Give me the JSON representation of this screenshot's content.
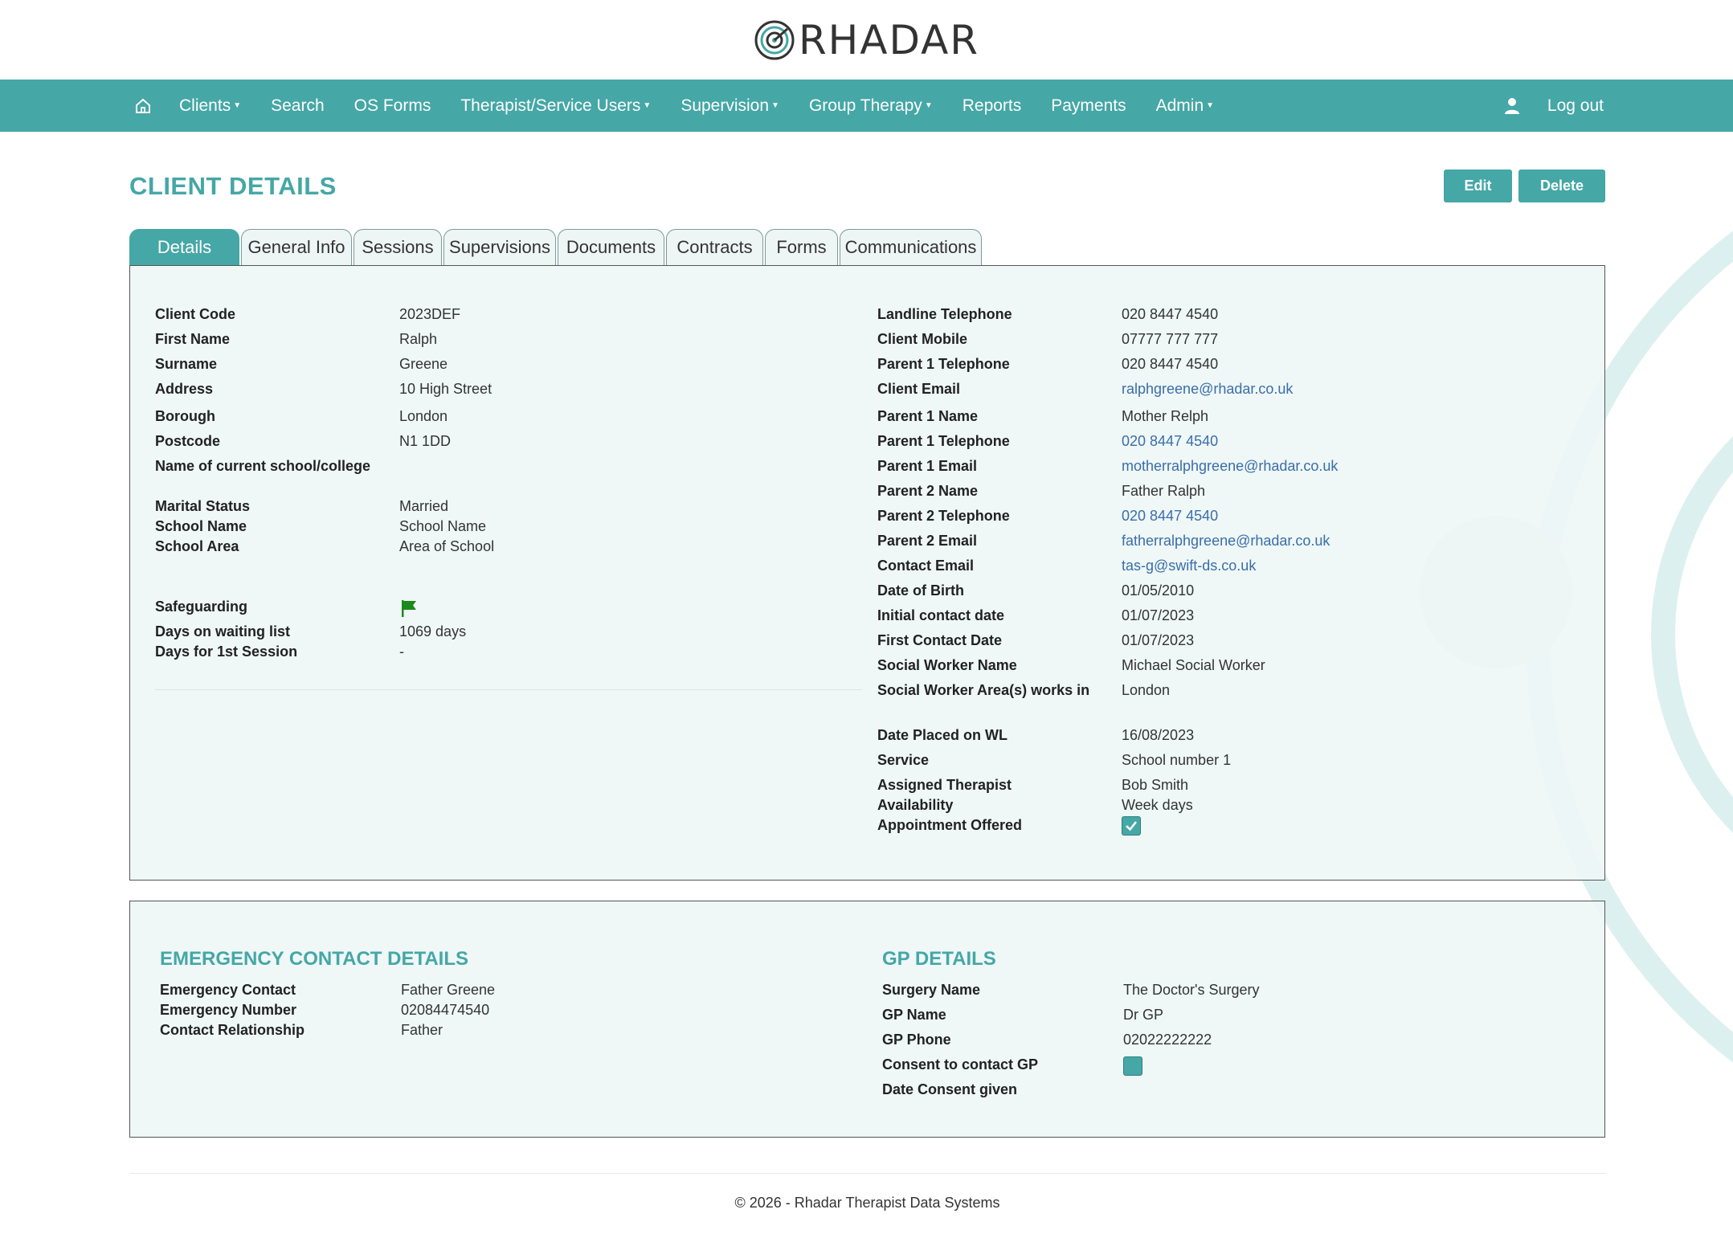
{
  "brand": {
    "name": "RHADAR"
  },
  "nav": {
    "home_icon": "home-icon",
    "items": [
      {
        "label": "Clients",
        "caret": true
      },
      {
        "label": "Search",
        "caret": false
      },
      {
        "label": "OS Forms",
        "caret": false
      },
      {
        "label": "Therapist/Service Users",
        "caret": true
      },
      {
        "label": "Supervision",
        "caret": true
      },
      {
        "label": "Group Therapy",
        "caret": true
      },
      {
        "label": "Reports",
        "caret": false
      },
      {
        "label": "Payments",
        "caret": false
      },
      {
        "label": "Admin",
        "caret": true
      }
    ],
    "user_icon": "user-icon",
    "logout": "Log out"
  },
  "page": {
    "title": "CLIENT DETAILS",
    "edit": "Edit",
    "delete": "Delete"
  },
  "tabs": [
    "Details",
    "General Info",
    "Sessions",
    "Supervisions",
    "Documents",
    "Contracts",
    "Forms",
    "Communications"
  ],
  "active_tab": "Details",
  "details": {
    "left": [
      {
        "label": "Client Code",
        "value": "2023DEF"
      },
      {
        "label": "First Name",
        "value": "Ralph"
      },
      {
        "label": "Surname",
        "value": "Greene"
      },
      {
        "label": "Address",
        "value": "10 High Street"
      },
      {
        "label": "Borough",
        "value": "London"
      },
      {
        "label": "Postcode",
        "value": "N1 1DD"
      },
      {
        "label": "Name of current school/college",
        "value": ""
      },
      {
        "label": "Marital Status",
        "value": "Married"
      },
      {
        "label": "School Name",
        "value": "School Name"
      },
      {
        "label": "School Area",
        "value": "Area of School"
      },
      {
        "label": "Safeguarding",
        "value": "flag-icon"
      },
      {
        "label": "Days on waiting list",
        "value": "1069 days"
      },
      {
        "label": "Days for 1st Session",
        "value": "-"
      }
    ],
    "right": [
      {
        "label": "Landline Telephone",
        "value": "020 8447 4540",
        "link": false
      },
      {
        "label": "Client Mobile",
        "value": "07777 777 777",
        "link": false
      },
      {
        "label": "Parent 1 Telephone",
        "value": "020 8447 4540",
        "link": false
      },
      {
        "label": "Client Email",
        "value": "ralphgreene@rhadar.co.uk",
        "link": true
      },
      {
        "label": "Parent 1 Name",
        "value": "Mother Relph",
        "link": false
      },
      {
        "label": "Parent 1 Telephone",
        "value": "020 8447 4540",
        "link": true
      },
      {
        "label": "Parent 1 Email",
        "value": "motherralphgreene@rhadar.co.uk",
        "link": true
      },
      {
        "label": "Parent 2 Name",
        "value": "Father Ralph",
        "link": false
      },
      {
        "label": "Parent 2 Telephone",
        "value": "020 8447 4540",
        "link": true
      },
      {
        "label": "Parent 2 Email",
        "value": "fatherralphgreene@rhadar.co.uk",
        "link": true
      },
      {
        "label": "Contact Email",
        "value": "tas-g@swift-ds.co.uk",
        "link": true
      },
      {
        "label": "Date of Birth",
        "value": "01/05/2010",
        "link": false
      },
      {
        "label": "Initial contact date",
        "value": "01/07/2023",
        "link": false
      },
      {
        "label": "First Contact Date",
        "value": "01/07/2023",
        "link": false
      },
      {
        "label": "Social Worker Name",
        "value": "Michael Social Worker",
        "link": false
      },
      {
        "label": "Social Worker Area(s) works in",
        "value": "London",
        "link": false
      },
      {
        "label": "Date Placed on WL",
        "value": "16/08/2023",
        "link": false
      },
      {
        "label": "Service",
        "value": "School number 1",
        "link": false
      },
      {
        "label": "Assigned Therapist",
        "value": "Bob Smith",
        "link": false
      },
      {
        "label": "Availability",
        "value": "Week days",
        "link": false
      },
      {
        "label": "Appointment Offered",
        "value": "checked",
        "link": false
      }
    ]
  },
  "emergency": {
    "title": "EMERGENCY CONTACT DETAILS",
    "rows": [
      {
        "label": "Emergency Contact",
        "value": "Father Greene"
      },
      {
        "label": "Emergency Number",
        "value": "02084474540"
      },
      {
        "label": "Contact Relationship",
        "value": "Father"
      }
    ]
  },
  "gp": {
    "title": "GP DETAILS",
    "rows": [
      {
        "label": "Surgery Name",
        "value": "The Doctor's Surgery"
      },
      {
        "label": "GP Name",
        "value": "Dr GP"
      },
      {
        "label": "GP Phone",
        "value": "02022222222"
      },
      {
        "label": "Consent to contact GP",
        "value": "unchecked"
      },
      {
        "label": "Date Consent given",
        "value": ""
      }
    ]
  },
  "footer": {
    "text": "© 2026 - Rhadar Therapist Data Systems"
  },
  "colors": {
    "accent": "#45a7a6",
    "link": "#3a6ea8",
    "panel_bg": "#eef6f6",
    "flag": "#1a8a1a"
  }
}
